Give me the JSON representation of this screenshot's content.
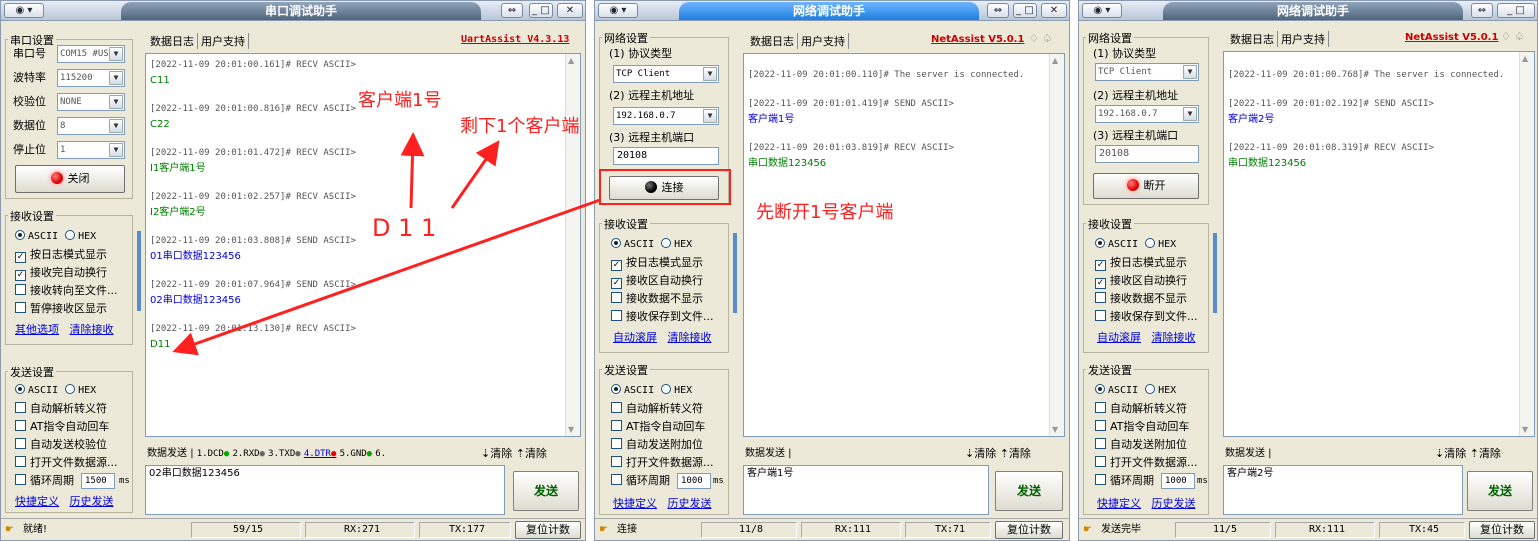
{
  "win1": {
    "title": "串口调试助手",
    "tabs": [
      "数据日志",
      "用户支持"
    ],
    "version": "UartAssist V4.3.13",
    "serial_group": "串口设置",
    "port_label": "串口号",
    "port_value": "COM15 #US",
    "baud_label": "波特率",
    "baud_value": "115200",
    "parity_label": "校验位",
    "parity_value": "NONE",
    "databits_label": "数据位",
    "databits_value": "8",
    "stopbits_label": "停止位",
    "stopbits_value": "1",
    "close_button": "关闭",
    "recv_group": "接收设置",
    "ascii": "ASCII",
    "hex": "HEX",
    "recv_opts": [
      "按日志模式显示",
      "接收完自动换行",
      "接收转向至文件...",
      "暂停接收区显示"
    ],
    "recv_checked": [
      "✓",
      "✓",
      "",
      ""
    ],
    "link_more": "其他选项",
    "link_clear": "清除接收",
    "send_group": "发送设置",
    "send_opts": [
      "自动解析转义符",
      "AT指令自动回车",
      "自动发送校验位",
      "打开文件数据源...",
      "循环周期"
    ],
    "cycle_value": "1500",
    "cycle_unit": "ms",
    "link_quick": "快捷定义",
    "link_history": "历史发送",
    "log": [
      {
        "ts": "[2022-11-09 20:01:00.161]# RECV ASCII>",
        "msg": "C11",
        "kind": "recv"
      },
      {
        "ts": "[2022-11-09 20:01:00.816]# RECV ASCII>",
        "msg": "C22",
        "kind": "recv"
      },
      {
        "ts": "[2022-11-09 20:01:01.472]# RECV ASCII>",
        "msg": "I1客户端1号",
        "kind": "recv"
      },
      {
        "ts": "[2022-11-09 20:01:02.257]# RECV ASCII>",
        "msg": "I2客户端2号",
        "kind": "recv"
      },
      {
        "ts": "[2022-11-09 20:01:03.808]# SEND ASCII>",
        "msg": "01串口数据123456",
        "kind": "send"
      },
      {
        "ts": "[2022-11-09 20:01:07.964]# SEND ASCII>",
        "msg": "02串口数据123456",
        "kind": "send"
      },
      {
        "ts": "[2022-11-09 20:01:13.130]# RECV ASCII>",
        "msg": "D11",
        "kind": "recv"
      }
    ],
    "send_tab": "数据发送",
    "signals": [
      "1.DCD",
      "2.RXD",
      "3.TXD",
      "4.DTR",
      "5.GND",
      "6."
    ],
    "clear1": "清除",
    "clear2": "清除",
    "send_text": "02串口数据123456",
    "send_button": "发送",
    "status": [
      "就绪!",
      "59/15",
      "RX:271",
      "TX:177",
      "复位计数"
    ]
  },
  "win2": {
    "title": "网络调试助手",
    "tabs": [
      "数据日志",
      "用户支持"
    ],
    "version": "NetAssist V5.0.1",
    "net_group": "网络设置",
    "proto_label": "(1) 协议类型",
    "proto_value": "TCP Client",
    "host_label": "(2) 远程主机地址",
    "host_value": "192.168.0.7",
    "port_label": "(3) 远程主机端口",
    "port_value": "20108",
    "connect_button": "连接",
    "recv_group": "接收设置",
    "ascii": "ASCII",
    "hex": "HEX",
    "recv_opts": [
      "按日志模式显示",
      "接收区自动换行",
      "接收数据不显示",
      "接收保存到文件..."
    ],
    "recv_checked": [
      "✓",
      "✓",
      "",
      ""
    ],
    "link_scroll": "自动滚屏",
    "link_clear": "清除接收",
    "send_group": "发送设置",
    "send_opts": [
      "自动解析转义符",
      "AT指令自动回车",
      "自动发送附加位",
      "打开文件数据源...",
      "循环周期"
    ],
    "cycle_value": "1000",
    "cycle_unit": "ms",
    "link_quick": "快捷定义",
    "link_history": "历史发送",
    "log": [
      {
        "ts": "[2022-11-09 20:01:00.110]# The server is connected.",
        "msg": "",
        "kind": "recv"
      },
      {
        "ts": "[2022-11-09 20:01:01.419]# SEND ASCII>",
        "msg": "客户端1号",
        "kind": "send"
      },
      {
        "ts": "[2022-11-09 20:01:03.819]# RECV ASCII>",
        "msg": "串口数据123456",
        "kind": "recv"
      }
    ],
    "send_tab": "数据发送",
    "clear1": "清除",
    "clear2": "清除",
    "send_text": "客户端1号",
    "send_button": "发送",
    "status": [
      "连接",
      "11/8",
      "RX:111",
      "TX:71",
      "复位计数"
    ]
  },
  "win3": {
    "title": "网络调试助手",
    "tabs": [
      "数据日志",
      "用户支持"
    ],
    "version": "NetAssist V5.0.1",
    "net_group": "网络设置",
    "proto_label": "(1) 协议类型",
    "proto_value": "TCP Client",
    "host_label": "(2) 远程主机地址",
    "host_value": "192.168.0.7",
    "port_label": "(3) 远程主机端口",
    "port_value": "20108",
    "disconnect_button": "断开",
    "recv_group": "接收设置",
    "ascii": "ASCII",
    "hex": "HEX",
    "recv_opts": [
      "按日志模式显示",
      "接收区自动换行",
      "接收数据不显示",
      "接收保存到文件..."
    ],
    "recv_checked": [
      "✓",
      "✓",
      "",
      ""
    ],
    "link_scroll": "自动滚屏",
    "link_clear": "清除接收",
    "send_group": "发送设置",
    "send_opts": [
      "自动解析转义符",
      "AT指令自动回车",
      "自动发送附加位",
      "打开文件数据源...",
      "循环周期"
    ],
    "cycle_value": "1000",
    "cycle_unit": "ms",
    "link_quick": "快捷定义",
    "link_history": "历史发送",
    "log": [
      {
        "ts": "[2022-11-09 20:01:00.768]# The server is connected.",
        "msg": "",
        "kind": "recv"
      },
      {
        "ts": "[2022-11-09 20:01:02.192]# SEND ASCII>",
        "msg": "客户端2号",
        "kind": "send"
      },
      {
        "ts": "[2022-11-09 20:01:08.319]# RECV ASCII>",
        "msg": "串口数据123456",
        "kind": "recv"
      }
    ],
    "send_tab": "数据发送",
    "clear1": "清除",
    "clear2": "清除",
    "send_text": "客户端2号",
    "send_button": "发送",
    "status": [
      "发送完毕",
      "11/5",
      "RX:111",
      "TX:45",
      "复位计数"
    ]
  },
  "annotations": {
    "client1": "客户端1号",
    "remaining": "剩下1个客户端",
    "d11": "D 1 1",
    "disconnect_first": "先断开1号客户端"
  },
  "colors": {
    "annotation": "#ff2020",
    "recv": "#008000",
    "send": "#0000e0",
    "version": "#cc0000"
  },
  "icons": [
    "menu-icon",
    "pin-icon",
    "minimize-icon",
    "close-icon",
    "status-icon",
    "scroll-up-icon",
    "scroll-down-icon"
  ]
}
